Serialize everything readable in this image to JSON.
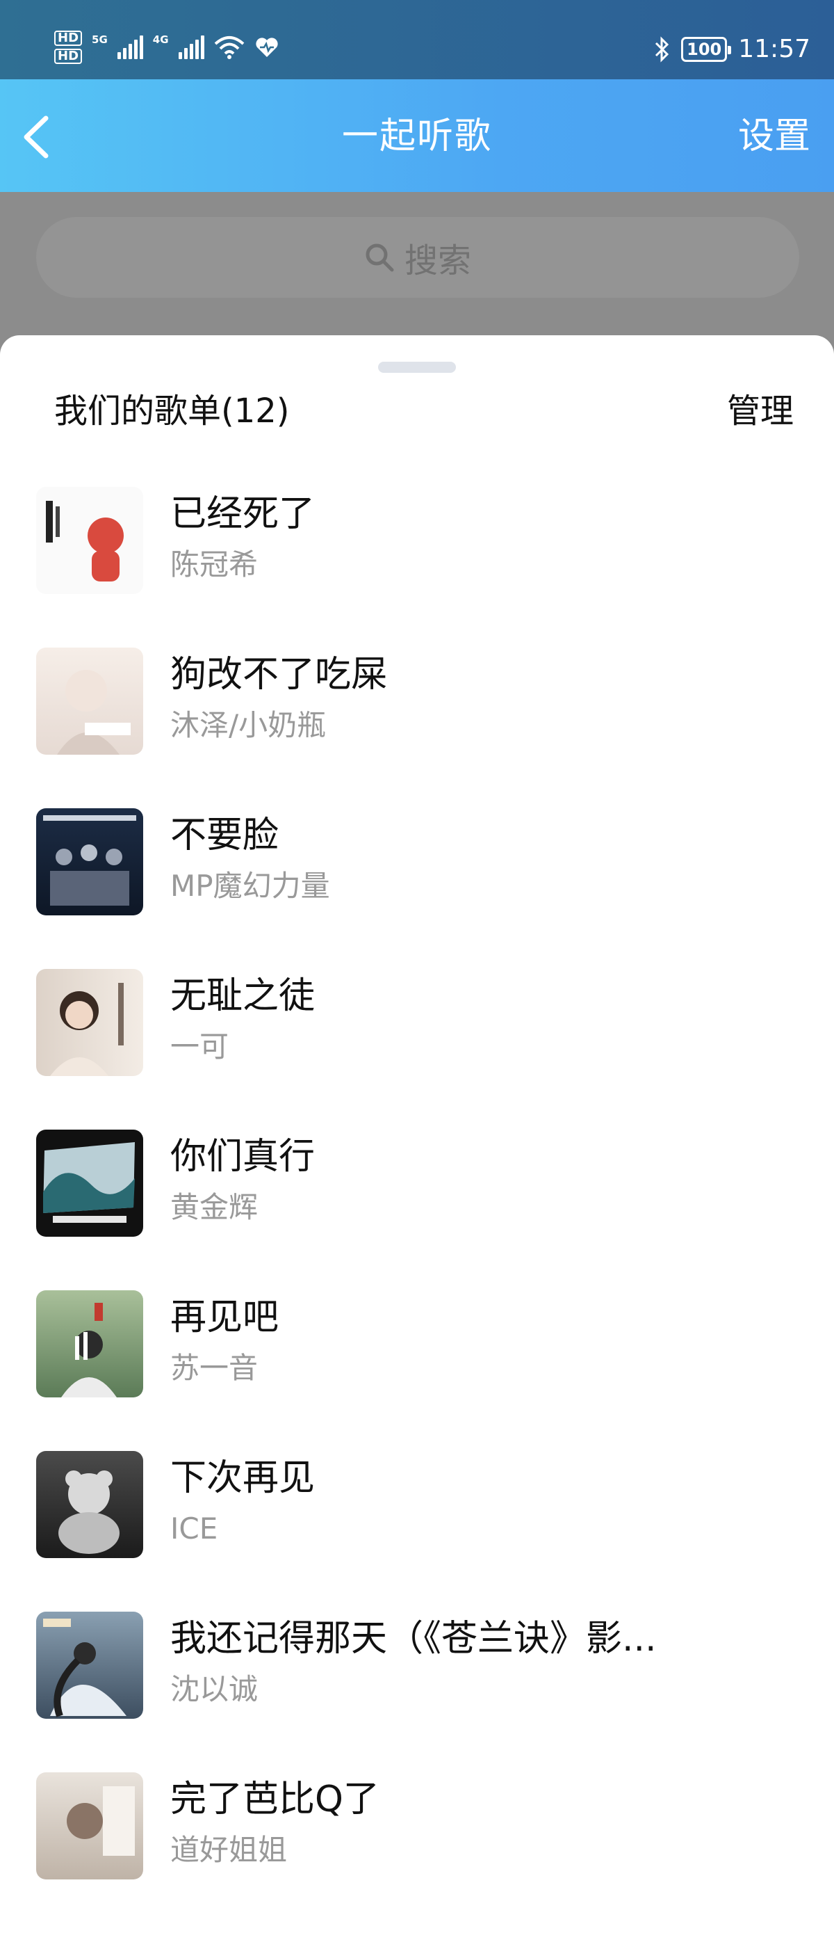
{
  "status_bar": {
    "hd1": "HD",
    "hd2": "HD",
    "net1": "5G",
    "net2": "4G",
    "wifi_icon": "wifi-icon",
    "heart_icon": "heart-icon",
    "bluetooth_icon": "bluetooth-icon",
    "battery": "100",
    "time": "11:57"
  },
  "navbar": {
    "title": "一起听歌",
    "settings_label": "设置",
    "back_icon": "chevron-left-icon"
  },
  "search": {
    "placeholder": "搜索",
    "icon": "search-icon"
  },
  "sheet": {
    "title": "我们的歌单(12)",
    "manage_label": "管理"
  },
  "songs": [
    {
      "title": "已经死了",
      "artist": "陈冠希"
    },
    {
      "title": "狗改不了吃屎",
      "artist": "沐泽/小奶瓶"
    },
    {
      "title": "不要脸",
      "artist": "MP魔幻力量"
    },
    {
      "title": "无耻之徒",
      "artist": "一可"
    },
    {
      "title": "你们真行",
      "artist": "黄金辉"
    },
    {
      "title": "再见吧",
      "artist": "苏一音"
    },
    {
      "title": "下次再见",
      "artist": "ICE"
    },
    {
      "title": "我还记得那天（《苍兰诀》影...",
      "artist": "沈以诚"
    },
    {
      "title": "完了芭比Q了",
      "artist": "道好姐姐"
    }
  ],
  "colors": {
    "status_bar": "#2f6f93",
    "navbar_start": "#56c5f5",
    "navbar_end": "#4a9ff1",
    "overlay": "#8c8c8c"
  }
}
